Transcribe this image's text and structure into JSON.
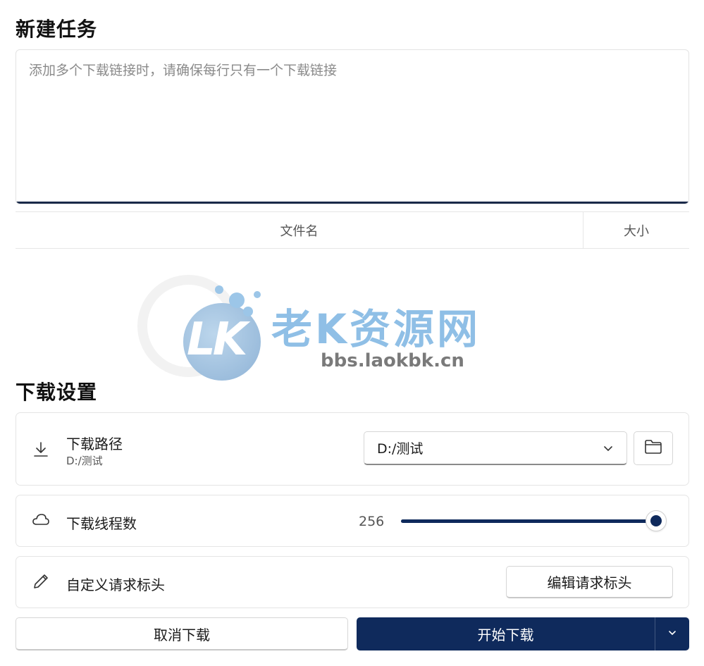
{
  "new_task": {
    "heading": "新建任务",
    "url_input_placeholder": "添加多个下载链接时，请确保每行只有一个下载链接",
    "url_input_value": ""
  },
  "file_table": {
    "columns": [
      "文件名",
      "大小"
    ]
  },
  "watermark": {
    "logo_letters": "LK",
    "site_name": "老K资源网",
    "site_url": "bbs.laokbk.cn"
  },
  "download_settings": {
    "heading": "下载设置",
    "path": {
      "title": "下载路径",
      "current": "D:/测试",
      "select_value": "D:/测试",
      "icon": "download-icon",
      "folder_icon": "folder-icon"
    },
    "threads": {
      "title": "下载线程数",
      "value": "256",
      "slider_fraction": 1.0,
      "icon": "cloud-icon"
    },
    "headers": {
      "title": "自定义请求标头",
      "edit_button": "编辑请求标头",
      "icon": "pencil-icon"
    }
  },
  "actions": {
    "cancel_label": "取消下载",
    "start_label": "开始下载"
  },
  "colors": {
    "accent": "#0f2a5c",
    "border": "#e5e5e5",
    "watermark_blue": "#8fbfe6"
  }
}
